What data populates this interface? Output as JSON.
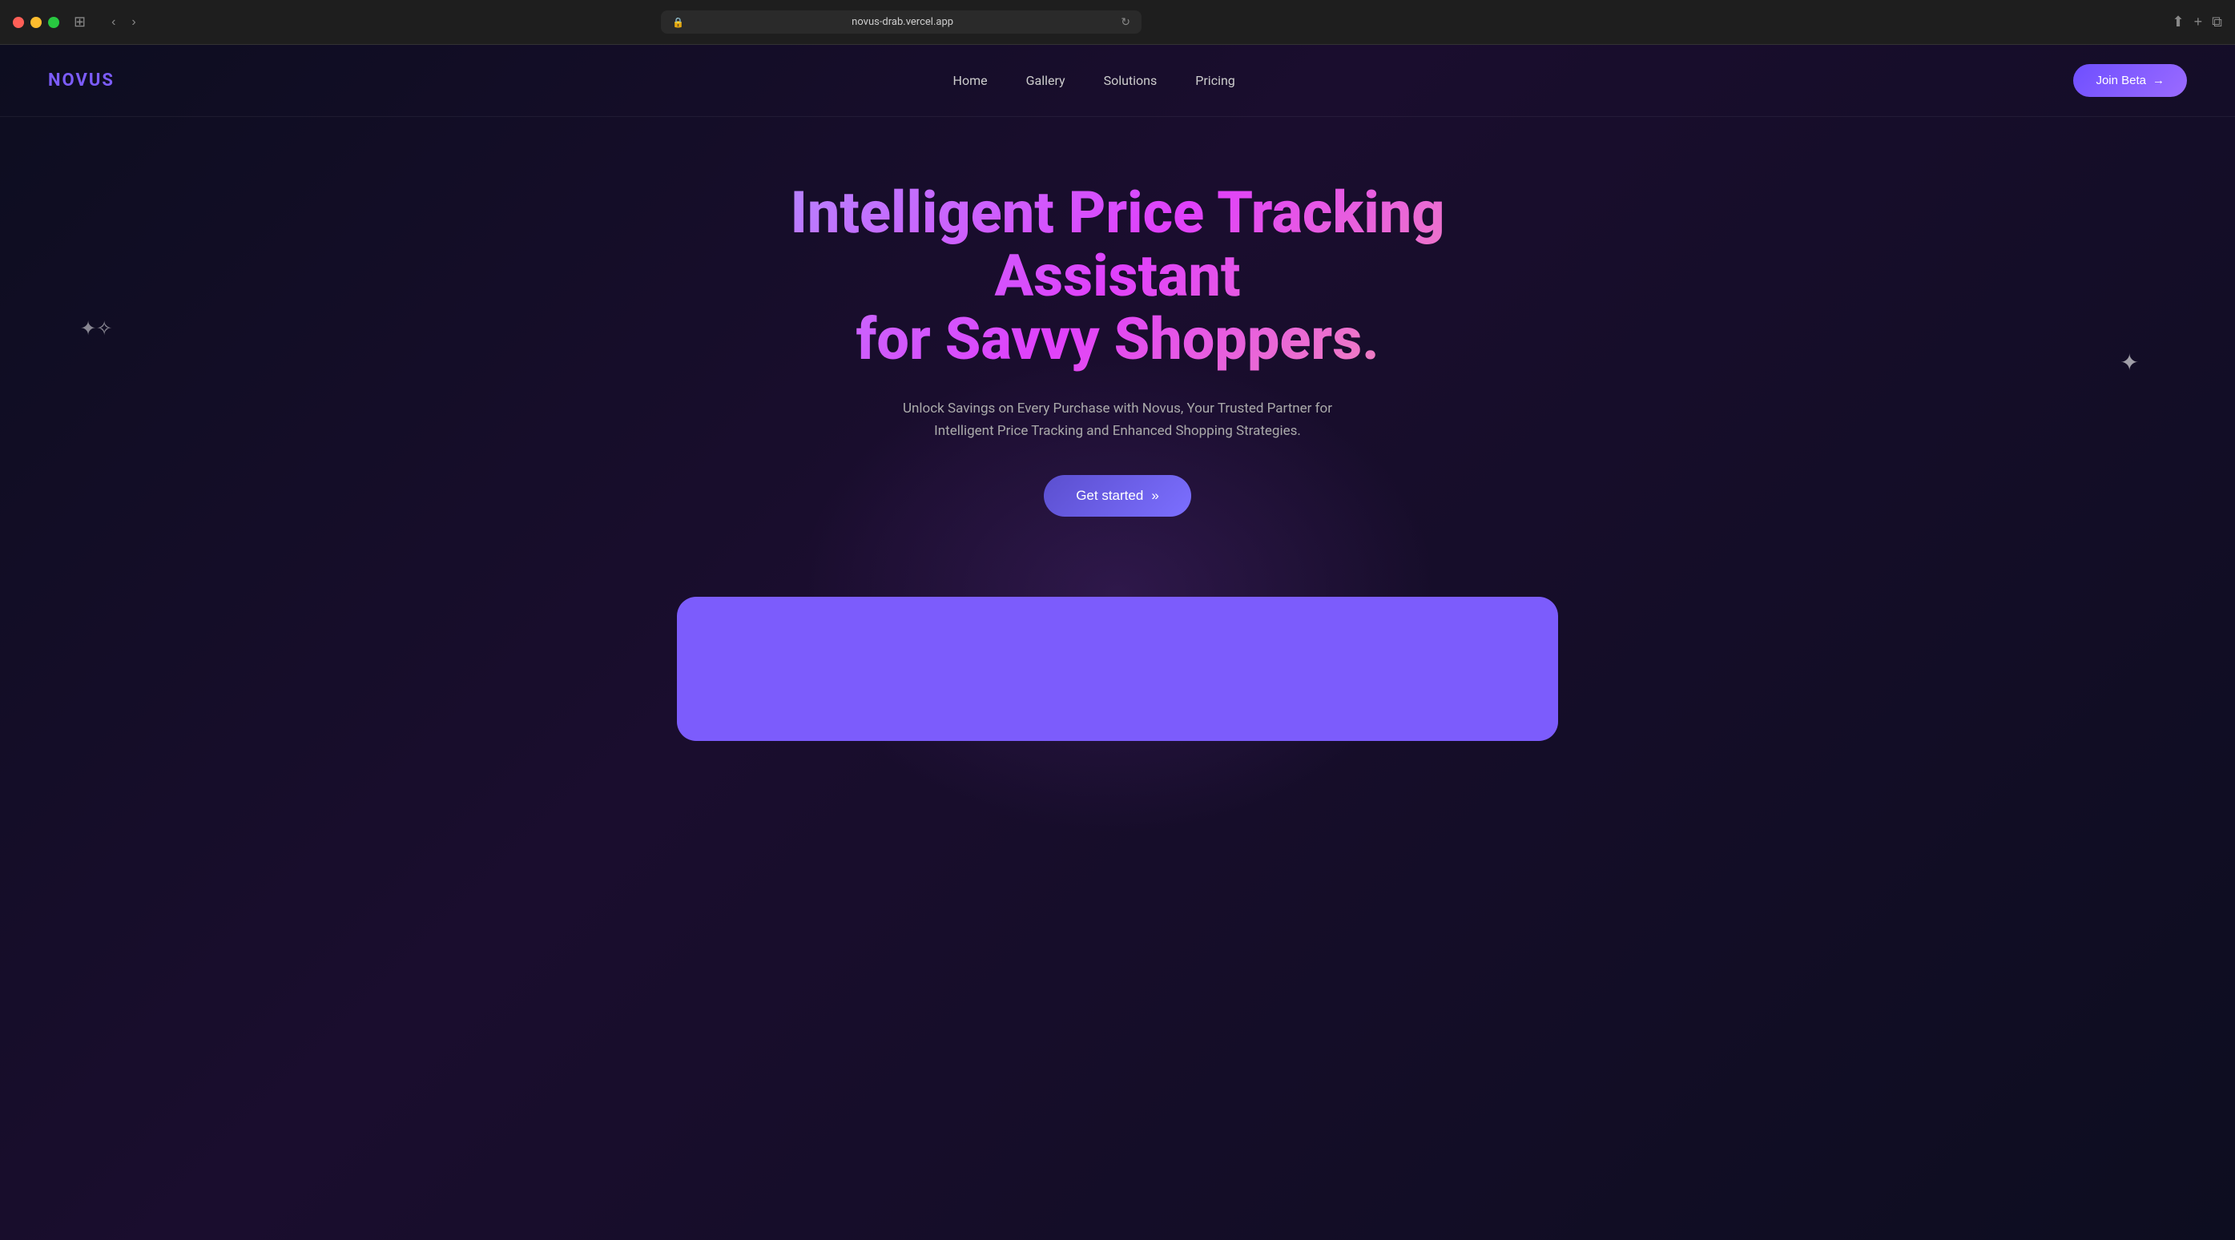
{
  "browser": {
    "url": "novus-drab.vercel.app",
    "traffic_lights": [
      "red",
      "yellow",
      "green"
    ]
  },
  "navbar": {
    "logo": "NOVUS",
    "links": [
      {
        "label": "Home"
      },
      {
        "label": "Gallery"
      },
      {
        "label": "Solutions"
      },
      {
        "label": "Pricing"
      }
    ],
    "cta_label": "Join Beta",
    "cta_arrow": "→"
  },
  "hero": {
    "title_line1": "Intelligent Price Tracking Assistant",
    "title_line2": "for Savvy Shoppers.",
    "subtitle": "Unlock Savings on Every Purchase with Novus, Your Trusted Partner for Intelligent Price Tracking and Enhanced Shopping Strategies.",
    "cta_label": "Get started",
    "cta_arrow": "»"
  },
  "colors": {
    "logo": "#7c5cfc",
    "background": "#0d0d20",
    "hero_gradient_start": "#b388ff",
    "hero_gradient_mid": "#e040fb",
    "hero_gradient_end": "#f48fb1",
    "cta_bg": "#5b4fcf",
    "preview_card": "#7c5cfc"
  }
}
